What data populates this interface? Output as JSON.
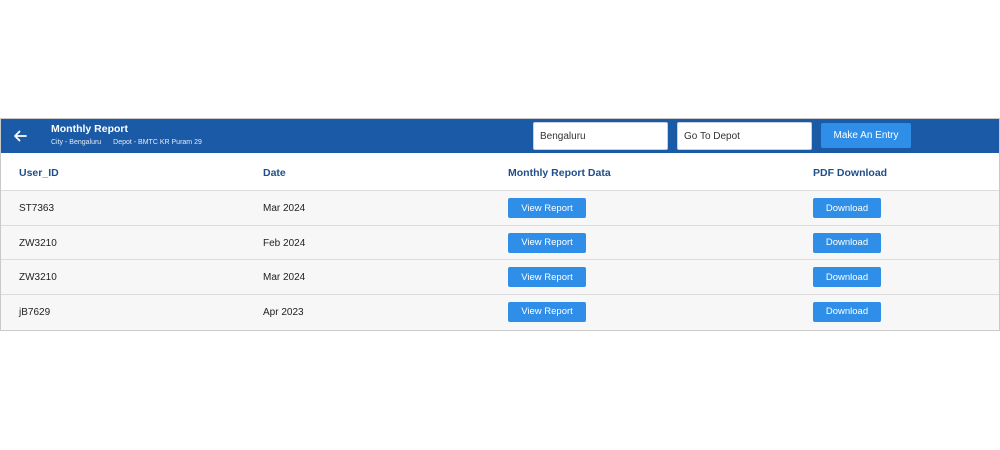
{
  "header": {
    "title": "Monthly Report",
    "city_info": "City - Bengaluru",
    "depot_info": "Depot - BMTC KR Puram 29",
    "back_icon": "arrow-left-icon",
    "city_input_value": "Bengaluru",
    "depot_input_value": "Go To Depot",
    "entry_button_label": "Make An Entry"
  },
  "table": {
    "columns": [
      "User_ID",
      "Date",
      "Monthly Report Data",
      "PDF Download"
    ],
    "view_label": "View Report",
    "download_label": "Download",
    "rows": [
      {
        "user_id": "ST7363",
        "date": "Mar 2024"
      },
      {
        "user_id": "ZW3210",
        "date": "Feb 2024"
      },
      {
        "user_id": "ZW3210",
        "date": "Mar 2024"
      },
      {
        "user_id": "jB7629",
        "date": "Apr 2023"
      }
    ]
  },
  "colors": {
    "header_bg": "#1a5aa6",
    "button_bg": "#2f8ee8",
    "column_header_text": "#1f4e8a"
  }
}
